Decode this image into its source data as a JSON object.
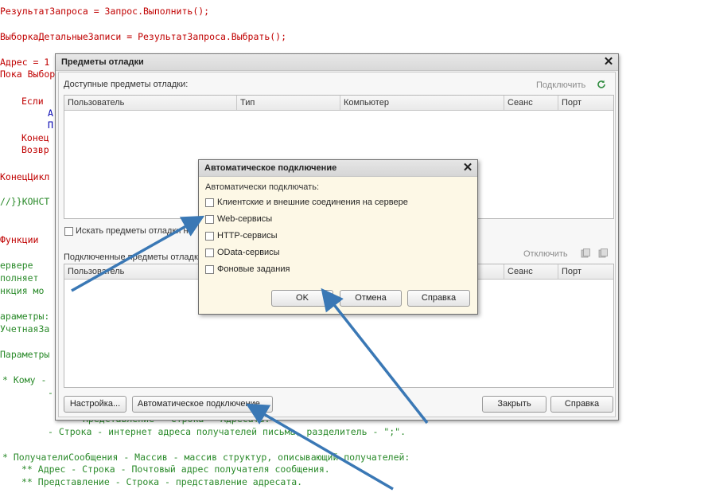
{
  "code": {
    "line1": "РезультатЗапроса = Запрос.Выполнить();",
    "line2": "ВыборкаДетальныеЗаписи = РезультатЗапроса.Выбрать();",
    "line3": "Адрес = 1",
    "line4": "Пока Выбор",
    "line5": "Если",
    "line6": "А",
    "line7": "П",
    "line8": "Конец",
    "line9": "Возвр",
    "line10": "КонецЦикл",
    "line11": "//}}КОНСТ",
    "line12": "Функции",
    "line13": "ервере",
    "line14": "полняет",
    "line15": "нкция мо",
    "line16": "араметры:",
    "line17": "УчетнаяЗа",
    "line18": "Параметры",
    "line19": "* Кому -",
    "line20": "-",
    "line21": "Представление - Строка - Адресата.",
    "line22": "- Строка - интернет адреса получателей письма, разделитель - \";\".",
    "line23": "* ПолучателиСообщения - Массив - массив структур, описывающий получателей:",
    "line24": "** Адрес - Строка - Почтовый адрес получателя сообщения.",
    "line25": "** Представление - Строка - представление адресата."
  },
  "main_window": {
    "title": "Предметы отладки",
    "available_label": "Доступные предметы отладки:",
    "connect_link": "Подключить",
    "columns": [
      "Пользователь",
      "Тип",
      "Компьютер",
      "Сеанс",
      "Порт"
    ],
    "search_checkbox_label": "Искать предметы отладки на",
    "connected_label": "Подключенные предметы отладки",
    "disconnect_link": "Отключить",
    "columns2": [
      "Пользователь",
      "Сеанс",
      "Порт"
    ],
    "settings_button": "Настройка...",
    "auto_connect_button": "Автоматическое подключение...",
    "close_button": "Закрыть",
    "help_button": "Справка"
  },
  "dialog": {
    "title": "Автоматическое подключение",
    "subtitle": "Автоматически подключать:",
    "options": [
      "Клиентские и внешние соединения на сервере",
      "Web-сервисы",
      "HTTP-сервисы",
      "OData-сервисы",
      "Фоновые задания"
    ],
    "ok_button": "OK",
    "cancel_button": "Отмена",
    "help_button": "Справка"
  },
  "colors": {
    "arrow": "#3a78b5",
    "dialog_bg": "#fdf8e6",
    "window_bg": "#f2f2f2"
  }
}
